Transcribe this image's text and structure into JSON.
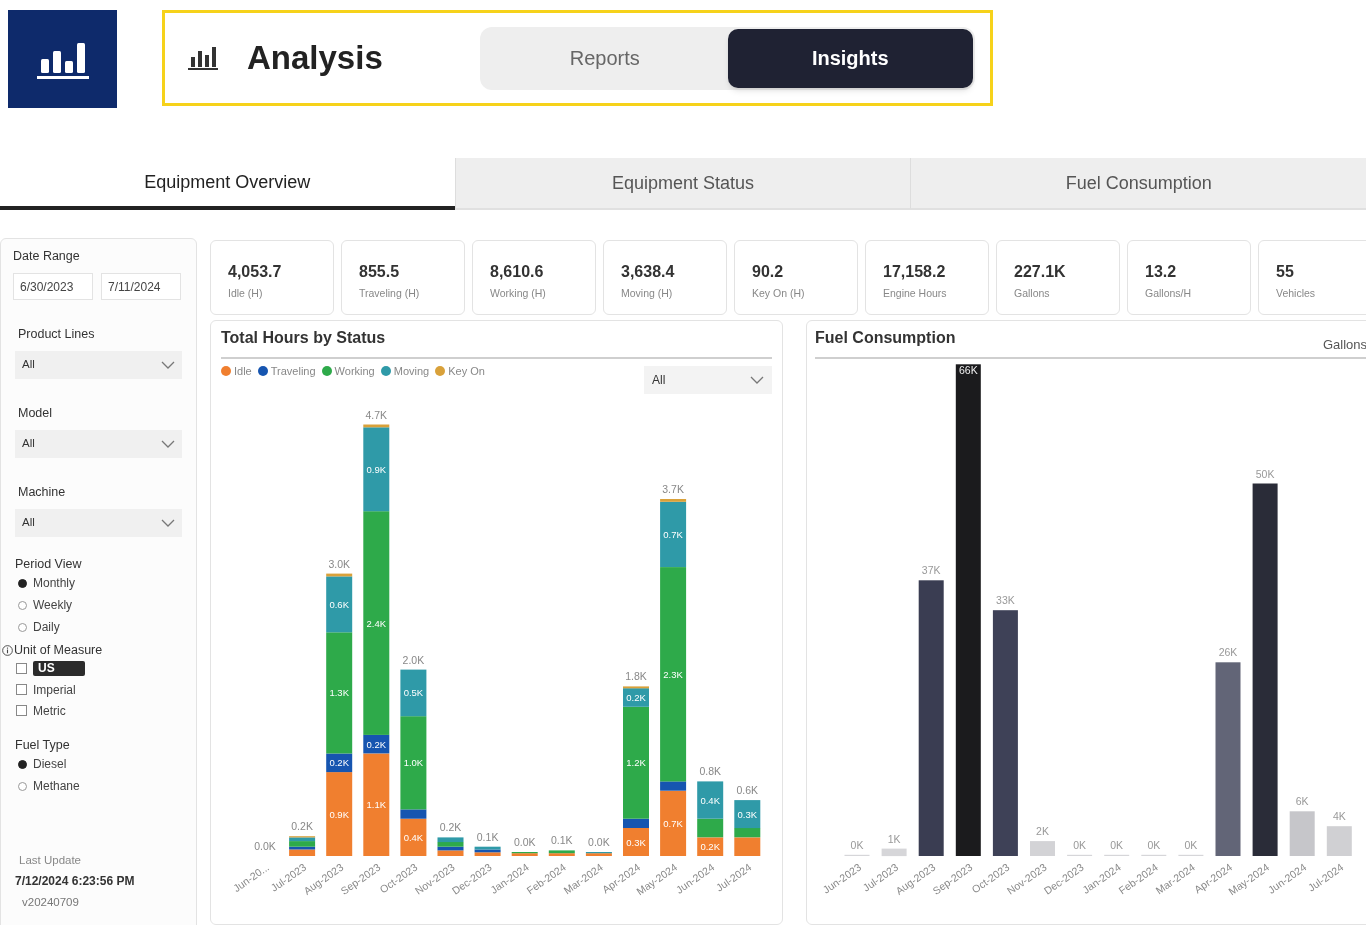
{
  "header": {
    "title": "Analysis",
    "segments": [
      {
        "label": "Reports",
        "selected": false
      },
      {
        "label": "Insights",
        "selected": true
      }
    ]
  },
  "tabs": [
    {
      "label": "Equipment Overview",
      "selected": true
    },
    {
      "label": "Equipment Status",
      "selected": false
    },
    {
      "label": "Fuel Consumption",
      "selected": false
    }
  ],
  "filters": {
    "date_range": {
      "label": "Date Range",
      "start": "6/30/2023",
      "end": "7/11/2024"
    },
    "dropdowns": [
      {
        "label": "Product Lines",
        "value": "All"
      },
      {
        "label": "Model",
        "value": "All"
      },
      {
        "label": "Machine",
        "value": "All"
      }
    ],
    "period_view": {
      "label": "Period View",
      "options": [
        {
          "label": "Monthly",
          "selected": true
        },
        {
          "label": "Weekly",
          "selected": false
        },
        {
          "label": "Daily",
          "selected": false
        }
      ]
    },
    "unit_of_measure": {
      "label": "Unit of Measure",
      "options": [
        {
          "label": "US",
          "selected": true,
          "checked": false
        },
        {
          "label": "Imperial",
          "selected": false,
          "checked": false
        },
        {
          "label": "Metric",
          "selected": false,
          "checked": false
        }
      ]
    },
    "fuel_type": {
      "label": "Fuel Type",
      "options": [
        {
          "label": "Diesel",
          "selected": true
        },
        {
          "label": "Methane",
          "selected": false
        }
      ]
    },
    "last_update": {
      "label": "Last Update",
      "value": "7/12/2024 6:23:56 PM",
      "version": "v20240709"
    }
  },
  "kpis": [
    {
      "value": "4,053.7",
      "label": "Idle (H)"
    },
    {
      "value": "855.5",
      "label": "Traveling (H)"
    },
    {
      "value": "8,610.6",
      "label": "Working (H)"
    },
    {
      "value": "3,638.4",
      "label": "Moving (H)"
    },
    {
      "value": "90.2",
      "label": "Key On (H)"
    },
    {
      "value": "17,158.2",
      "label": "Engine Hours"
    },
    {
      "value": "227.1K",
      "label": "Gallons"
    },
    {
      "value": "13.2",
      "label": "Gallons/H"
    },
    {
      "value": "55",
      "label": "Vehicles"
    }
  ],
  "hours_chart": {
    "title": "Total Hours by Status",
    "filter": "All",
    "chart_data": {
      "type": "bar",
      "stacked": true,
      "categories": [
        "Jun-20...",
        "Jul-2023",
        "Aug-2023",
        "Sep-2023",
        "Oct-2023",
        "Nov-2023",
        "Dec-2023",
        "Jan-2024",
        "Feb-2024",
        "Mar-2024",
        "Apr-2024",
        "May-2024",
        "Jun-2024",
        "Jul-2024"
      ],
      "annotations": [
        "0.0K",
        "0.2K",
        "3.0K",
        "4.7K",
        "2.0K",
        "0.2K",
        "0.1K",
        "0.0K",
        "0.1K",
        "0.0K",
        "1.8K",
        "3.7K",
        "0.8K",
        "0.6K"
      ],
      "series": [
        {
          "name": "Idle",
          "color": "#f07f2f",
          "values": [
            null,
            0.07,
            0.9,
            1.1,
            0.4,
            0.06,
            0.04,
            0.03,
            0.03,
            0.03,
            0.3,
            0.7,
            0.2,
            0.2
          ],
          "value_labels": [
            null,
            null,
            "0.9K",
            "1.1K",
            "0.4K",
            null,
            null,
            null,
            null,
            null,
            "0.3K",
            "0.7K",
            "0.2K",
            null
          ]
        },
        {
          "name": "Traveling",
          "color": "#1655b0",
          "values": [
            null,
            0.03,
            0.2,
            0.2,
            0.1,
            0.04,
            0.03,
            null,
            null,
            null,
            0.1,
            0.1,
            null,
            null
          ],
          "value_labels": [
            null,
            null,
            "0.2K",
            "0.2K",
            null,
            null,
            null,
            null,
            null,
            null,
            null,
            null,
            null,
            null
          ]
        },
        {
          "name": "Working",
          "color": "#2eaa4a",
          "values": [
            null,
            0.06,
            1.3,
            2.4,
            1.0,
            0.05,
            null,
            0.01,
            0.03,
            null,
            1.2,
            2.3,
            0.2,
            0.1
          ],
          "value_labels": [
            null,
            null,
            "1.3K",
            "2.4K",
            "1.0K",
            null,
            null,
            null,
            null,
            null,
            "1.2K",
            "2.3K",
            null,
            null
          ]
        },
        {
          "name": "Moving",
          "color": "#2f9aa8",
          "values": [
            null,
            0.04,
            0.6,
            0.9,
            0.5,
            0.05,
            0.03,
            null,
            null,
            0.01,
            0.2,
            0.7,
            0.4,
            0.3
          ],
          "value_labels": [
            null,
            null,
            "0.6K",
            "0.9K",
            "0.5K",
            null,
            null,
            null,
            null,
            null,
            "0.2K",
            "0.7K",
            "0.4K",
            "0.3K"
          ]
        },
        {
          "name": "Key On",
          "color": "#d9a13a",
          "values": [
            null,
            0.01,
            0.03,
            0.03,
            null,
            null,
            null,
            null,
            null,
            null,
            0.02,
            0.03,
            null,
            null
          ]
        }
      ]
    }
  },
  "fuel_chart": {
    "title": "Fuel Consumption",
    "chart_data": {
      "type": "bar",
      "categories": [
        "Jun-2023",
        "Jul-2023",
        "Aug-2023",
        "Sep-2023",
        "Oct-2023",
        "Nov-2023",
        "Dec-2023",
        "Jan-2024",
        "Feb-2024",
        "Mar-2024",
        "Apr-2024",
        "May-2024",
        "Jun-2024",
        "Jul-2024"
      ],
      "series": [
        {
          "name": "Gallons",
          "values": [
            0,
            1,
            37,
            66,
            33,
            2,
            0,
            0,
            0,
            0,
            26,
            50,
            6,
            4
          ],
          "value_labels": [
            "0K",
            "1K",
            "37K",
            "66K",
            "33K",
            "2K",
            "0K",
            "0K",
            "0K",
            "0K",
            "26K",
            "50K",
            "6K",
            "4K"
          ],
          "colors": [
            "#d6d6d9",
            "#d6d6d9",
            "#3a3d52",
            "#1b1b1d",
            "#3e4157",
            "#d3d3d6",
            "#d6d6d9",
            "#d6d6d9",
            "#d6d6d9",
            "#d6d6d9",
            "#626577",
            "#2a2c38",
            "#c6c6ca",
            "#d0d0d3"
          ]
        }
      ]
    }
  }
}
